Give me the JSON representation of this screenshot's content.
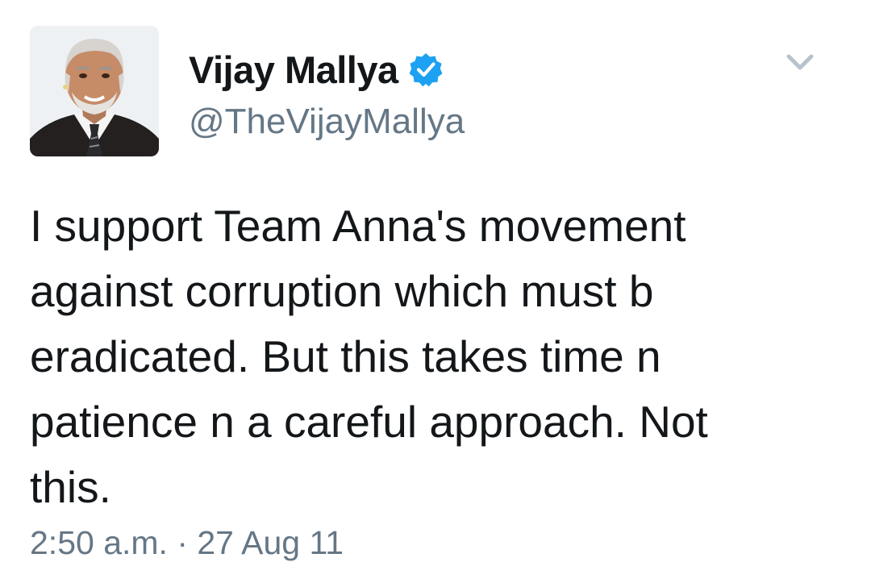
{
  "tweet": {
    "display_name": "Vijay Mallya",
    "handle": "@TheVijayMallya",
    "verified_icon": "verified-badge-icon",
    "menu_icon": "chevron-down-icon",
    "text": "I support Team Anna's movement\nagainst corruption which must b\neradicated. But this takes time n\npatience n a careful approach. Not\nthis.",
    "timestamp": "2:50 a.m. · 27 Aug 11"
  },
  "colors": {
    "verified_blue": "#1da1f2",
    "secondary_text": "#657786",
    "primary_text": "#14171a"
  }
}
